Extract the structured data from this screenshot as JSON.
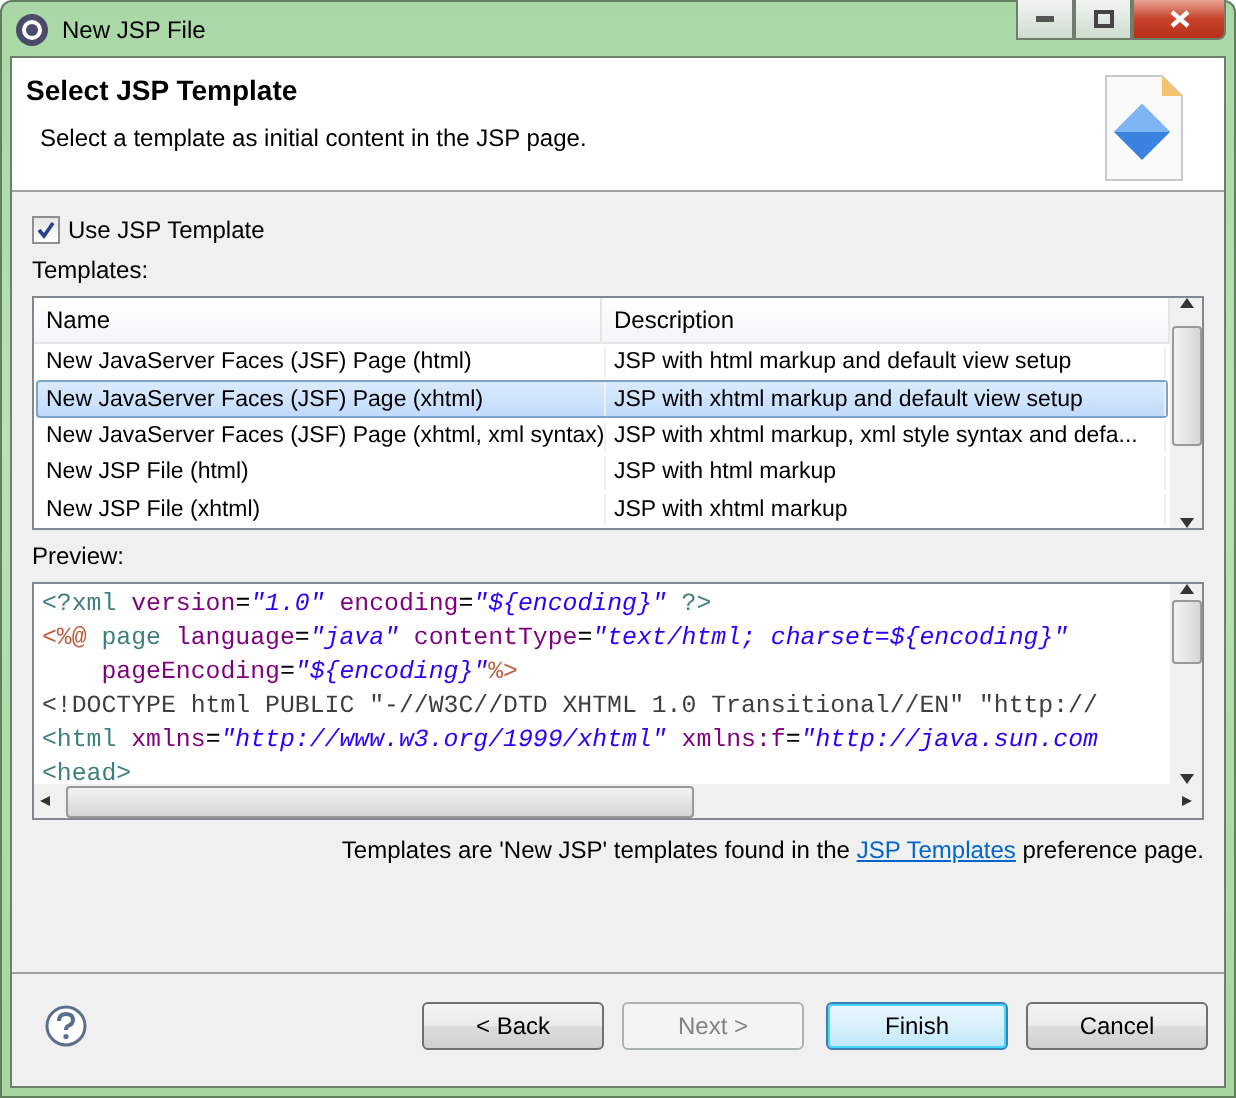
{
  "window": {
    "title": "New JSP File"
  },
  "header": {
    "title": "Select JSP Template",
    "description": "Select a template as initial content in the JSP page."
  },
  "use_template": {
    "label": "Use JSP Template",
    "checked": true
  },
  "templates_label": "Templates:",
  "table": {
    "columns": [
      "Name",
      "Description"
    ],
    "rows": [
      {
        "name": "New JavaServer Faces (JSF) Page (html)",
        "description": "JSP with html markup and default view setup",
        "selected": false
      },
      {
        "name": "New JavaServer Faces (JSF) Page (xhtml)",
        "description": "JSP with xhtml markup and default view setup",
        "selected": true
      },
      {
        "name": "New JavaServer Faces (JSF) Page (xhtml, xml syntax)",
        "description": "JSP with xhtml markup, xml style syntax and defa...",
        "selected": false
      },
      {
        "name": "New JSP File (html)",
        "description": "JSP with html markup",
        "selected": false
      },
      {
        "name": "New JSP File (xhtml)",
        "description": "JSP with xhtml markup",
        "selected": false
      }
    ]
  },
  "preview_label": "Preview:",
  "preview_lines": [
    [
      {
        "kind": "tag",
        "text": "<?xml"
      },
      {
        "kind": "attr",
        "text": " version"
      },
      {
        "kind": "plain",
        "text": "="
      },
      {
        "kind": "value",
        "text": "\"1.0\""
      },
      {
        "kind": "attr",
        "text": " encoding"
      },
      {
        "kind": "plain",
        "text": "="
      },
      {
        "kind": "value",
        "text": "\"${encoding}\""
      },
      {
        "kind": "tag",
        "text": " ?>"
      }
    ],
    [
      {
        "kind": "directive",
        "text": "<%@"
      },
      {
        "kind": "tag",
        "text": " page"
      },
      {
        "kind": "attr",
        "text": " language"
      },
      {
        "kind": "plain",
        "text": "="
      },
      {
        "kind": "value",
        "text": "\"java\""
      },
      {
        "kind": "attr",
        "text": " contentType"
      },
      {
        "kind": "plain",
        "text": "="
      },
      {
        "kind": "value",
        "text": "\"text/html; charset=${encoding}\""
      }
    ],
    [
      {
        "kind": "attr",
        "text": "    pageEncoding"
      },
      {
        "kind": "plain",
        "text": "="
      },
      {
        "kind": "value",
        "text": "\"${encoding}\""
      },
      {
        "kind": "directive",
        "text": "%>"
      }
    ],
    [
      {
        "kind": "doctype",
        "text": "<!DOCTYPE html PUBLIC \"-//W3C//DTD XHTML 1.0 Transitional//EN\" \"http://"
      }
    ],
    [
      {
        "kind": "tag",
        "text": "<html"
      },
      {
        "kind": "attr",
        "text": " xmlns"
      },
      {
        "kind": "plain",
        "text": "="
      },
      {
        "kind": "value",
        "text": "\"http://www.w3.org/1999/xhtml\""
      },
      {
        "kind": "attr",
        "text": " xmlns:f"
      },
      {
        "kind": "plain",
        "text": "="
      },
      {
        "kind": "value",
        "text": "\"http://java.sun.com"
      }
    ],
    [
      {
        "kind": "tag",
        "text": "<head>"
      }
    ]
  ],
  "info": {
    "before": "Templates are 'New JSP' templates found in the ",
    "link": "JSP Templates",
    "after": " preference page."
  },
  "buttons": [
    {
      "label": "< Back",
      "disabled": false,
      "default": false
    },
    {
      "label": "Next >",
      "disabled": true,
      "default": false
    },
    {
      "label": "Finish",
      "disabled": false,
      "default": true
    },
    {
      "label": "Cancel",
      "disabled": false,
      "default": false
    }
  ]
}
